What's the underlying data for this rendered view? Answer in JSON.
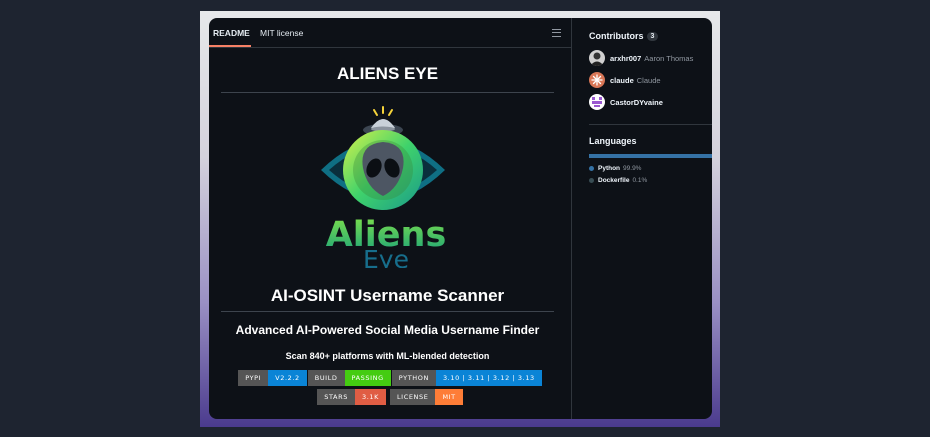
{
  "tabs": {
    "readme": "README",
    "license": "MIT license"
  },
  "readme": {
    "title": "ALIENS EYE",
    "logo_word1": "Aliens",
    "logo_word2": "Eye",
    "heading": "AI-OSINT Username Scanner",
    "subtitle": "Advanced AI-Powered Social Media Username Finder",
    "tagline": "Scan 840+ platforms with ML-blended detection",
    "badges_row1": [
      {
        "label": "PYPI",
        "value": "V2.2.2",
        "color": "#0a84d6"
      },
      {
        "label": "BUILD",
        "value": "PASSING",
        "color": "#44cc11"
      },
      {
        "label": "PYTHON",
        "value": "3.10 | 3.11 | 3.12 | 3.13",
        "color": "#0a84d6"
      }
    ],
    "badges_row2": [
      {
        "label": "STARS",
        "value": "3.1K",
        "color": "#e05d44"
      },
      {
        "label": "LICENSE",
        "value": "MIT",
        "color": "#fe7d37"
      }
    ]
  },
  "contributors": {
    "title": "Contributors",
    "count": "3",
    "list": [
      {
        "login": "arxhr007",
        "name": "Aaron Thomas"
      },
      {
        "login": "claude",
        "name": "Claude"
      },
      {
        "login": "CastorDYvaine",
        "name": ""
      }
    ]
  },
  "languages": {
    "title": "Languages",
    "list": [
      {
        "name": "Python",
        "percent": "99.9%",
        "fraction": 0.999,
        "color": "#3572A5"
      },
      {
        "name": "Dockerfile",
        "percent": "0.1%",
        "fraction": 0.001,
        "color": "#384d54"
      }
    ]
  }
}
